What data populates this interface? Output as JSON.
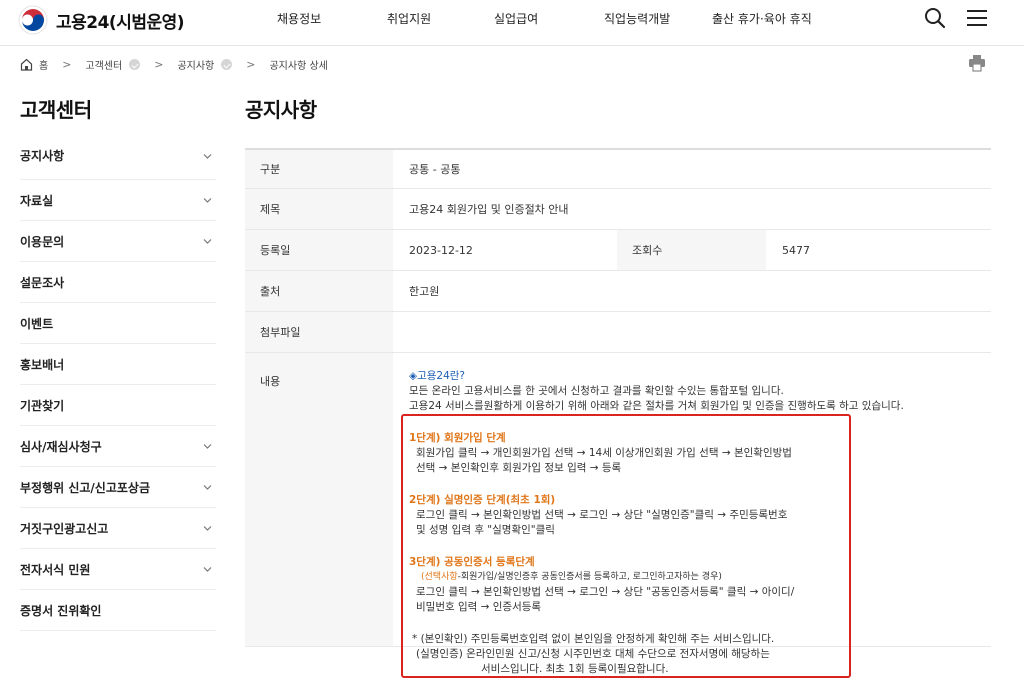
{
  "header": {
    "logo_text": "고용24(시범운영)",
    "nav": [
      "채용정보",
      "취업지원",
      "실업급여",
      "직업능력개발",
      "출산 휴가·육아 휴직"
    ]
  },
  "breadcrumb": {
    "home": "홈",
    "items": [
      "고객센터",
      "공지사항",
      "공지사항 상세"
    ]
  },
  "sidebar": {
    "title": "고객센터",
    "items": [
      {
        "label": "공지사항",
        "expandable": true
      },
      {
        "label": "자료실",
        "expandable": true
      },
      {
        "label": "이용문의",
        "expandable": true
      },
      {
        "label": "설문조사",
        "expandable": false
      },
      {
        "label": "이벤트",
        "expandable": false
      },
      {
        "label": "홍보배너",
        "expandable": false
      },
      {
        "label": "기관찾기",
        "expandable": false
      },
      {
        "label": "심사/재심사청구",
        "expandable": true
      },
      {
        "label": "부정행위 신고/신고포상금",
        "expandable": true
      },
      {
        "label": "거짓구인광고신고",
        "expandable": true
      },
      {
        "label": "전자서식 민원",
        "expandable": true
      },
      {
        "label": "증명서 진위확인",
        "expandable": false
      }
    ]
  },
  "page_title": "공지사항",
  "detail": {
    "category_label": "구분",
    "category_value": "공통 - 공통",
    "title_label": "제목",
    "title_value": "고용24 회원가입 및 인증절차 안내",
    "date_label": "등록일",
    "date_value": "2023-12-12",
    "views_label": "조회수",
    "views_value": "5477",
    "source_label": "출처",
    "source_value": "한고원",
    "attach_label": "첨부파일",
    "attach_value": "",
    "content_label": "내용"
  },
  "content": {
    "intro_title": "◈고용24란?",
    "intro_1": "모든 온라인 고용서비스를 한 곳에서 신청하고 결과를 확인할 수있는 통합포털 입니다.",
    "intro_2": "고용24 서비스를원활하게 이용하기 위해 아래와 같은 절차를 거쳐 회원가입 및 인증을 진행하도록 하고 있습니다.",
    "step1_title": "1단계) 회원가입 단계",
    "step1_l1": "회원가입 클릭 → 개인회원가입 선택 → 14세 이상개인회원 가입 선택 → 본인확인방법",
    "step1_l2": "선택 → 본인확인후 회원가입 정보 입력 → 등록",
    "step2_title": "2단계) 실명인증 단계(최초 1회)",
    "step2_l1": "로그인 클릭 → 본인확인방법 선택 → 로그인 → 상단 \"실명인증\"클릭 → 주민등록번호",
    "step2_l2": "및 성명 입력 후 \"실명확인\"클릭",
    "step3_title": "3단계) 공동인증서 등록단계",
    "step3_note_hl": "(선택사항",
    "step3_note": "-회원가입/실명인증후 공동인증서를 등록하고, 로그인하고자하는 경우)",
    "step3_l1": "로그인 클릭 → 본인확인방법 선택 → 로그인 → 상단 \"공동인증서등록\" 클릭 → 아이디/",
    "step3_l2": "비밀번호 입력 → 인증서등록",
    "foot_1": "* (본인확인) 주민등록번호입력 없이 본인임을 안정하게 확인해 주는 서비스입니다.",
    "foot_2": "(실명인증) 온라인민원 신고/신청 시주민번호 대체 수단으로 전자서명에 해당하는",
    "foot_3": "서비스입니다. 최초 1회 등록이필요합니다."
  },
  "colors": {
    "accent_orange": "#e0761a",
    "highlight_red": "#d9251d",
    "link_blue": "#1d5fb3"
  }
}
